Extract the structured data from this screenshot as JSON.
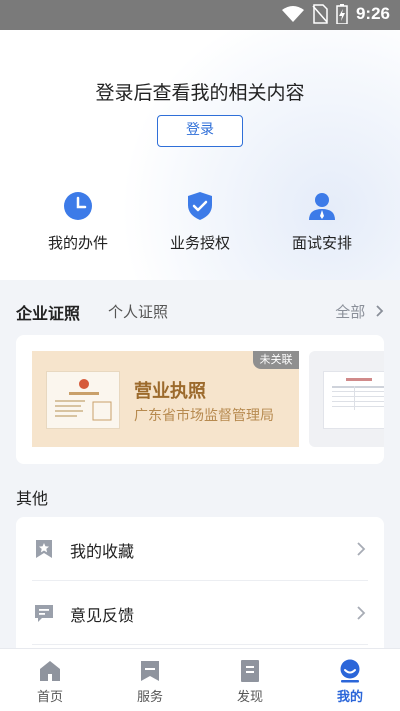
{
  "status_bar": {
    "time": "9:26",
    "icons": [
      "wifi-icon",
      "no-sim-icon",
      "battery-charging-icon"
    ]
  },
  "header": {
    "login_prompt": "登录后查看我的相关内容",
    "login_button": "登录"
  },
  "shortcuts": [
    {
      "label": "我的办件",
      "icon": "clock-icon"
    },
    {
      "label": "业务授权",
      "icon": "shield-check-icon"
    },
    {
      "label": "面试安排",
      "icon": "person-icon"
    }
  ],
  "certificates": {
    "tabs": [
      "企业证照",
      "个人证照"
    ],
    "all_label": "全部",
    "items": [
      {
        "name": "营业执照",
        "issuer": "广东省市场监督管理局",
        "badge": "未关联"
      }
    ]
  },
  "other": {
    "title": "其他",
    "items": [
      {
        "label": "我的收藏",
        "icon": "bookmark-star-icon"
      },
      {
        "label": "意见反馈",
        "icon": "feedback-icon"
      }
    ]
  },
  "tabbar": {
    "items": [
      {
        "label": "首页",
        "icon": "home-icon"
      },
      {
        "label": "服务",
        "icon": "service-icon"
      },
      {
        "label": "发现",
        "icon": "discover-icon"
      },
      {
        "label": "我的",
        "icon": "profile-icon"
      }
    ],
    "active_index": 3
  },
  "colors": {
    "accent": "#2f6fd8",
    "license_bg": "#f6e4cc",
    "license_text": "#9c6a2c"
  }
}
